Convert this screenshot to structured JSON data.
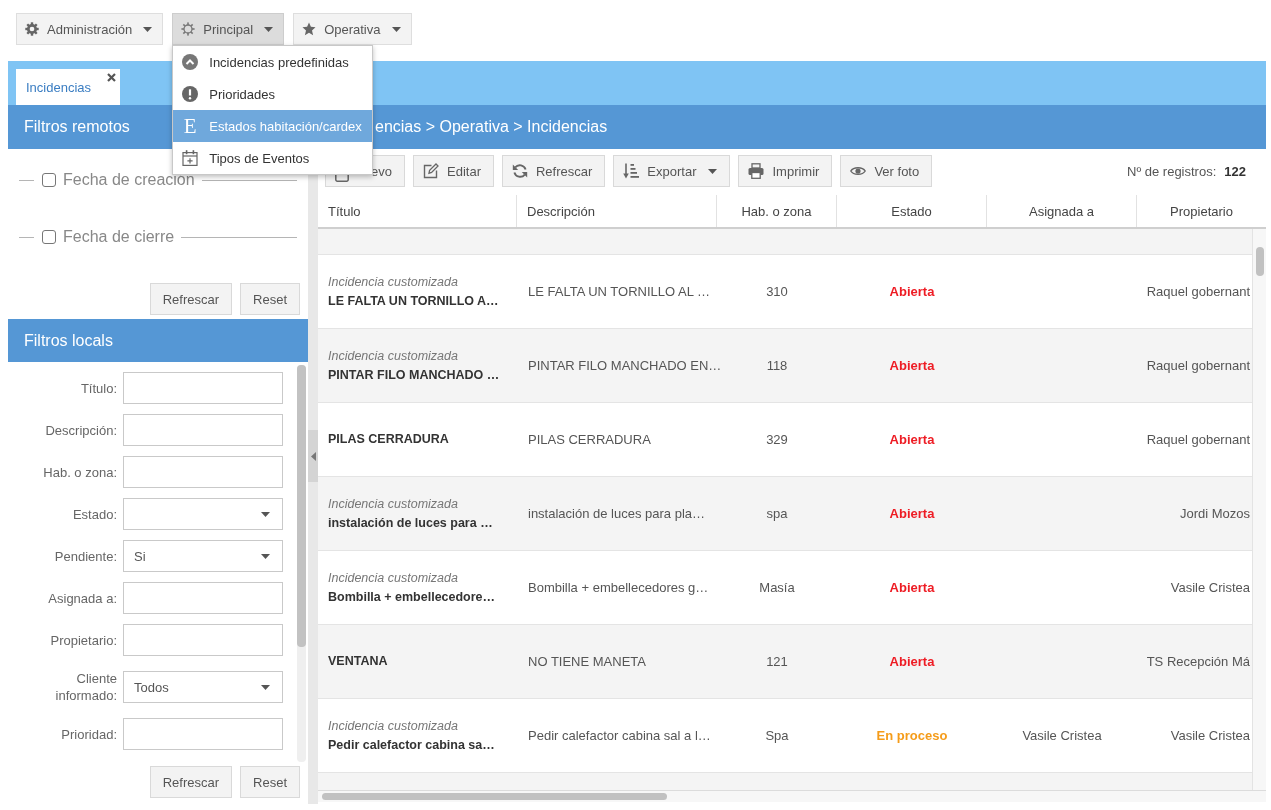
{
  "top_menu": [
    {
      "label": "Administración",
      "selected": false
    },
    {
      "label": "Principal",
      "selected": true
    },
    {
      "label": "Operativa",
      "selected": false
    }
  ],
  "dropdown": {
    "items": [
      {
        "label": "Incidencias predefinidas",
        "selected": false
      },
      {
        "label": "Prioridades",
        "selected": false
      },
      {
        "label": "Estados habitación/cardex",
        "selected": true,
        "glyph": "E"
      },
      {
        "label": "Tipos de Eventos",
        "selected": false
      }
    ]
  },
  "tabs": [
    {
      "label": "Incidencias",
      "selected": true
    }
  ],
  "header": {
    "title": "Filtros remotos",
    "breadcrumb": "encias > Operativa > Incidencias"
  },
  "remote_filters": {
    "date_filters": [
      {
        "label": "Fecha de creación",
        "checked": false
      },
      {
        "label": "Fecha de cierre",
        "checked": false
      }
    ],
    "buttons": [
      "Refrescar",
      "Reset"
    ]
  },
  "local_filters": {
    "title": "Filtros locals",
    "fields": [
      {
        "label": "Título:",
        "kind": "text"
      },
      {
        "label": "Descripción:",
        "kind": "text"
      },
      {
        "label": "Hab. o zona:",
        "kind": "text"
      },
      {
        "label": "Estado:",
        "kind": "select"
      },
      {
        "label": "Pendiente:",
        "kind": "select",
        "value": "Si"
      },
      {
        "label": "Asignada a:",
        "kind": "text"
      },
      {
        "label": "Propietario:",
        "kind": "text"
      },
      {
        "label": "Cliente informado:",
        "kind": "select",
        "value": "Todos"
      },
      {
        "label": "Prioridad:",
        "kind": "text"
      }
    ],
    "buttons": [
      "Refrescar",
      "Reset"
    ]
  },
  "toolbar": {
    "buttons": [
      {
        "label": "evo"
      },
      {
        "label": "Editar"
      },
      {
        "label": "Refrescar"
      },
      {
        "label": "Exportar",
        "dropdown": true
      },
      {
        "label": "Imprimir"
      },
      {
        "label": "Ver foto"
      }
    ],
    "count_label": "Nº de registros:",
    "count": "122"
  },
  "table": {
    "columns": [
      "Título",
      "Descripción",
      "Hab. o zona",
      "Estado",
      "Asignada a",
      "Propietario"
    ],
    "rows": [
      {
        "subtitle": "Incidencia customizada",
        "title": "LE FALTA UN TORNILLO A…",
        "description": "LE FALTA UN TORNILLO AL …",
        "hab": "310",
        "estado": {
          "label": "Abierta",
          "color": "#ee1c24"
        },
        "owner": "Raquel gobernant"
      },
      {
        "subtitle": "Incidencia customizada",
        "title": "PINTAR FILO MANCHADO …",
        "description": "PINTAR FILO MANCHADO EN…",
        "hab": "118",
        "estado": {
          "label": "Abierta",
          "color": "#ee1c24"
        },
        "owner": "Raquel gobernant"
      },
      {
        "title": "PILAS CERRADURA",
        "description": "PILAS CERRADURA",
        "hab": "329",
        "estado": {
          "label": "Abierta",
          "color": "#ee1c24"
        },
        "owner": "Raquel gobernant"
      },
      {
        "subtitle": "Incidencia customizada",
        "title": "instalación de luces para …",
        "description": "instalación de luces para pla…",
        "hab": "spa",
        "estado": {
          "label": "Abierta",
          "color": "#ee1c24"
        },
        "owner": "Jordi Mozos"
      },
      {
        "subtitle": "Incidencia customizada",
        "title": "Bombilla + embellecedore…",
        "description": "Bombilla + embellecedores g…",
        "hab": "Masía",
        "estado": {
          "label": "Abierta",
          "color": "#ee1c24"
        },
        "owner": "Vasile Cristea"
      },
      {
        "title": "VENTANA",
        "description": "NO TIENE MANETA",
        "hab": "121",
        "estado": {
          "label": "Abierta",
          "color": "#ee1c24"
        },
        "owner": "TS Recepción Má"
      },
      {
        "subtitle": "Incidencia customizada",
        "title": "Pedir calefactor cabina sa…",
        "description": "Pedir calefactor cabina sal a l…",
        "hab": "Spa",
        "estado": {
          "label": "En proceso",
          "color": "#f59c1a"
        },
        "assignee": "Vasile Cristea",
        "owner": "Vasile Cristea"
      }
    ]
  }
}
